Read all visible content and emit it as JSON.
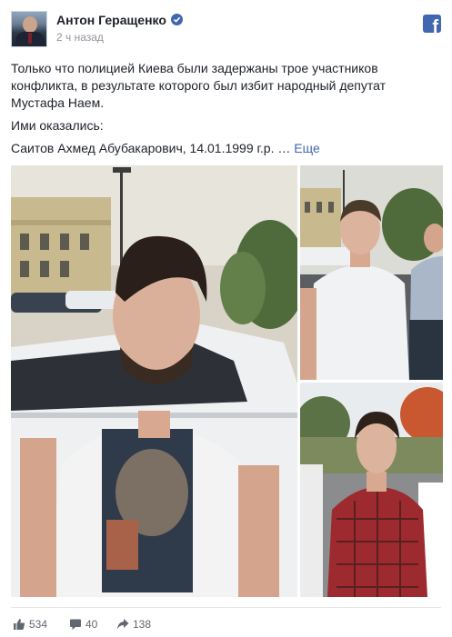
{
  "post": {
    "author": "Антон Геращенко",
    "timestamp": "2 ч назад",
    "text": {
      "paragraph1": "Только что полицией Киева были задержаны трое участников конфликта, в результате которого был избит народный депутат Мустафа Наем.",
      "paragraph2": "Ими оказались:",
      "paragraph3": "Саитов Ахмед Абубакарович, 14.01.1999 г.р. …",
      "more_link": "Еще"
    }
  },
  "reactions": {
    "likes": "534",
    "comments": "40",
    "shares": "138"
  },
  "icons": {
    "verified": "verified-badge-icon",
    "platform": "facebook-logo-icon",
    "like": "thumbs-up-icon",
    "comment": "comment-bubble-icon",
    "share": "share-arrow-icon"
  },
  "colors": {
    "brand": "#4267b2",
    "text": "#1d2129",
    "meta": "#90949c",
    "actions": "#616770"
  }
}
